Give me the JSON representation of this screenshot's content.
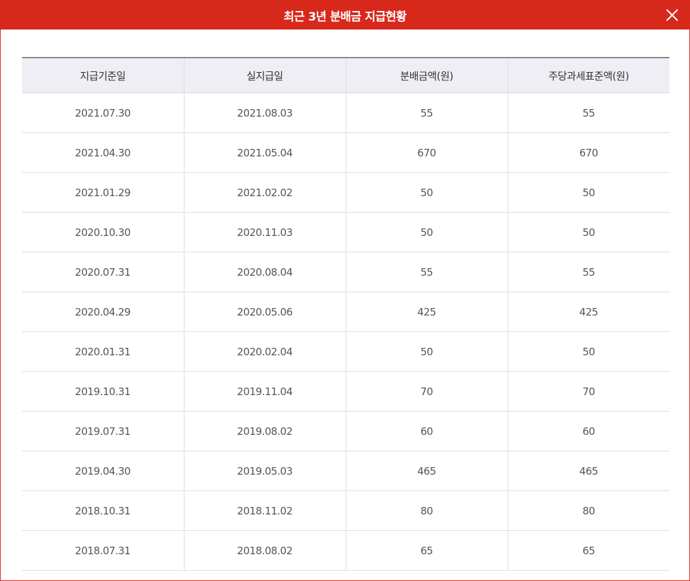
{
  "modal": {
    "title": "최근 3년 분배금 지급현황",
    "accent_color": "#d7281b",
    "close_icon": "close-icon"
  },
  "table": {
    "headers": [
      "지급기준일",
      "실지급일",
      "분배금액(원)",
      "주당과세표준액(원)"
    ],
    "rows": [
      [
        "2021.07.30",
        "2021.08.03",
        "55",
        "55"
      ],
      [
        "2021.04.30",
        "2021.05.04",
        "670",
        "670"
      ],
      [
        "2021.01.29",
        "2021.02.02",
        "50",
        "50"
      ],
      [
        "2020.10.30",
        "2020.11.03",
        "50",
        "50"
      ],
      [
        "2020.07.31",
        "2020.08.04",
        "55",
        "55"
      ],
      [
        "2020.04.29",
        "2020.05.06",
        "425",
        "425"
      ],
      [
        "2020.01.31",
        "2020.02.04",
        "50",
        "50"
      ],
      [
        "2019.10.31",
        "2019.11.04",
        "70",
        "70"
      ],
      [
        "2019.07.31",
        "2019.08.02",
        "60",
        "60"
      ],
      [
        "2019.04.30",
        "2019.05.03",
        "465",
        "465"
      ],
      [
        "2018.10.31",
        "2018.11.02",
        "80",
        "80"
      ],
      [
        "2018.07.31",
        "2018.08.02",
        "65",
        "65"
      ]
    ]
  }
}
